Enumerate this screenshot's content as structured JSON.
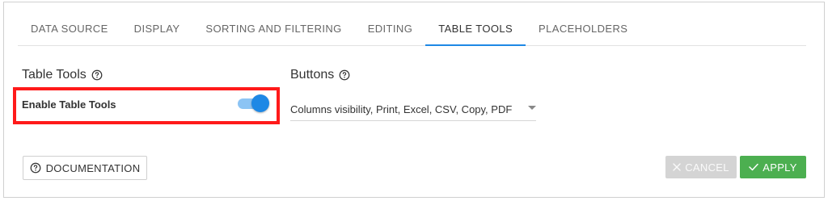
{
  "tabs": [
    {
      "label": "DATA SOURCE"
    },
    {
      "label": "DISPLAY"
    },
    {
      "label": "SORTING AND FILTERING"
    },
    {
      "label": "EDITING"
    },
    {
      "label": "TABLE TOOLS"
    },
    {
      "label": "PLACEHOLDERS"
    }
  ],
  "active_tab": "TABLE TOOLS",
  "table_tools": {
    "title": "Table Tools",
    "toggle_label": "Enable Table Tools",
    "enabled": true
  },
  "buttons_section": {
    "title": "Buttons",
    "selected_value": "Columns visibility, Print, Excel, CSV, Copy, PDF"
  },
  "footer": {
    "documentation_label": "DOCUMENTATION",
    "cancel_label": "CANCEL",
    "apply_label": "APPLY"
  },
  "icons": {
    "help": "question-circle-icon",
    "cancel": "close-icon",
    "apply": "check-icon"
  },
  "colors": {
    "accent": "#1e88e5",
    "highlight": "#ff1a1a",
    "apply": "#4caf50",
    "cancel_disabled": "#d4d4d4"
  }
}
